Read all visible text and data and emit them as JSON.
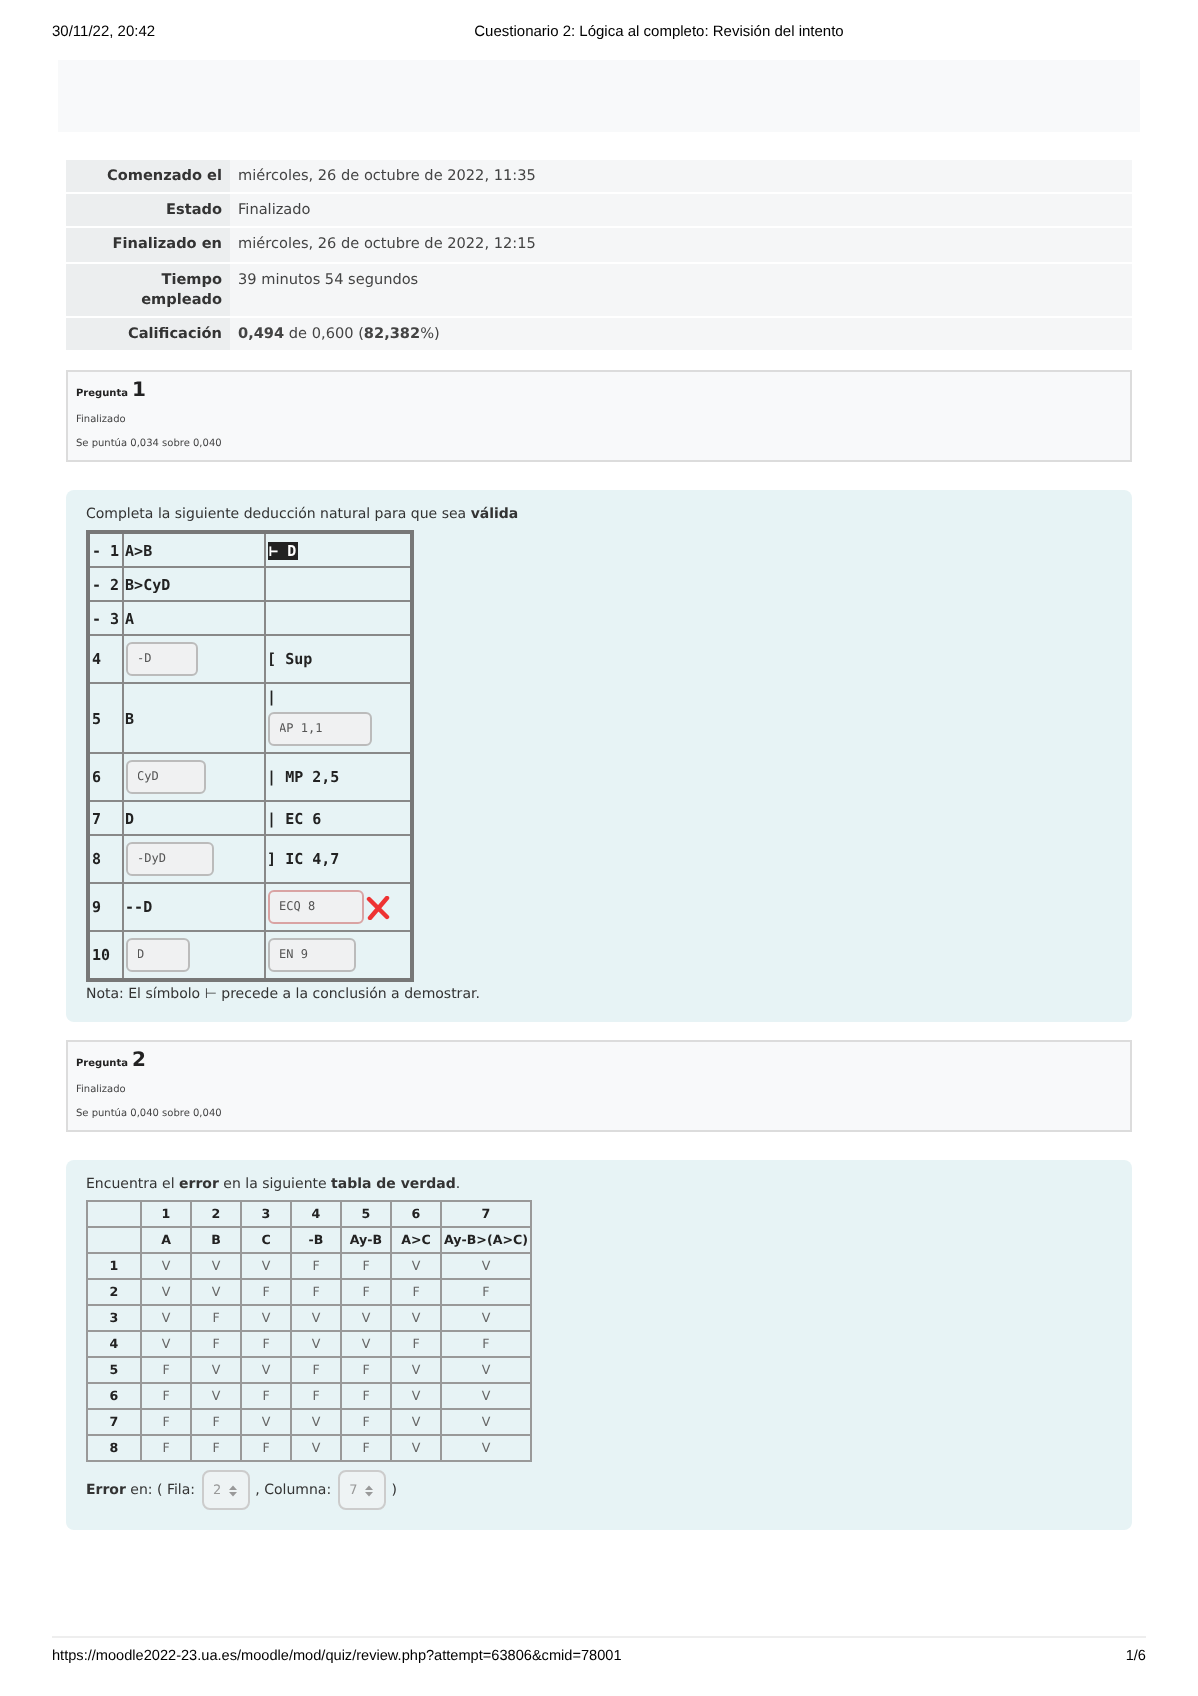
{
  "print_header": {
    "date": "30/11/22, 20:42",
    "title": "Cuestionario 2: Lógica al completo: Revisión del intento"
  },
  "summary": [
    {
      "label": "Comenzado el",
      "value": "miércoles, 26 de octubre de 2022, 11:35"
    },
    {
      "label": "Estado",
      "value": "Finalizado"
    },
    {
      "label": "Finalizado en",
      "value": "miércoles, 26 de octubre de 2022, 12:15"
    },
    {
      "label": "Tiempo empleado",
      "value": "39 minutos 54 segundos"
    },
    {
      "label": "Calificación",
      "value": "**0,494** de 0,600 (**82,382**%)"
    }
  ],
  "questions": [
    {
      "label": "Pregunta",
      "number": "1",
      "state": "Finalizado",
      "score": "Se puntúa 0,034 sobre 0,040",
      "kind": "deduction",
      "prompt": "Completa la siguiente deducción natural para que sea **válida**",
      "rows": [
        {
          "number": "- 1",
          "formula": {
            "kind": "text",
            "text": "A>B"
          },
          "justification": {
            "kind": "text",
            "text": "⊢ D",
            "highlighted": true
          }
        },
        {
          "number": "- 2",
          "formula": {
            "kind": "text",
            "text": "B>CyD"
          }
        },
        {
          "number": "- 3",
          "formula": {
            "kind": "text",
            "text": "A"
          }
        },
        {
          "number": "4",
          "formula": {
            "kind": "field",
            "value": "-D",
            "wrong": false
          },
          "justification": {
            "kind": "text",
            "text": "[ Sup",
            "highlighted": false
          }
        },
        {
          "number": "5",
          "formula": {
            "kind": "text",
            "text": "B"
          },
          "justification": {
            "kind": "field",
            "prefix": "|",
            "value": "AP 1,1",
            "wrong": false
          }
        },
        {
          "number": "6",
          "formula": {
            "kind": "field",
            "value": "CyD",
            "wrong": false
          },
          "justification": {
            "kind": "text",
            "text": "| MP 2,5",
            "highlighted": false
          }
        },
        {
          "number": "7",
          "formula": {
            "kind": "text",
            "text": "D"
          },
          "justification": {
            "kind": "text",
            "text": "| EC 6",
            "highlighted": false
          }
        },
        {
          "number": "8",
          "formula": {
            "kind": "field",
            "value": "-DyD",
            "wrong": false
          },
          "justification": {
            "kind": "text",
            "text": "] IC 4,7",
            "highlighted": false
          }
        },
        {
          "number": "9",
          "formula": {
            "kind": "text",
            "text": "--D"
          },
          "justification": {
            "kind": "field",
            "value": "ECQ 8",
            "wrong": true
          }
        },
        {
          "number": "10",
          "formula": {
            "kind": "field",
            "value": "D",
            "wrong": false
          },
          "justification": {
            "kind": "field",
            "value": "EN 9",
            "wrong": false
          }
        }
      ],
      "note": "Nota: El símbolo ⊢ precede a la conclusión a demostrar."
    },
    {
      "label": "Pregunta",
      "number": "2",
      "state": "Finalizado",
      "score": "Se puntúa 0,040 sobre 0,040",
      "kind": "truth_table",
      "prompt": "Encuentra el **error** en la siguiente **tabla de verdad**.",
      "header_rows": [
        [
          "",
          "1",
          "2",
          "3",
          "4",
          "5",
          "6",
          "7"
        ],
        [
          "",
          "A",
          "B",
          "C",
          "-B",
          "Ay-B",
          "A>C",
          "Ay-B>(A>C)"
        ]
      ],
      "rows": [
        [
          "1",
          "V",
          "V",
          "V",
          "F",
          "F",
          "V",
          "V"
        ],
        [
          "2",
          "V",
          "V",
          "F",
          "F",
          "F",
          "F",
          "F"
        ],
        [
          "3",
          "V",
          "F",
          "V",
          "V",
          "V",
          "V",
          "V"
        ],
        [
          "4",
          "V",
          "F",
          "F",
          "V",
          "V",
          "F",
          "F"
        ],
        [
          "5",
          "F",
          "V",
          "V",
          "F",
          "F",
          "V",
          "V"
        ],
        [
          "6",
          "F",
          "V",
          "F",
          "F",
          "F",
          "V",
          "V"
        ],
        [
          "7",
          "F",
          "F",
          "V",
          "V",
          "F",
          "V",
          "V"
        ],
        [
          "8",
          "F",
          "F",
          "F",
          "V",
          "F",
          "V",
          "V"
        ]
      ],
      "answer": {
        "lead": "**Error** en: ( Fila:",
        "row_value": "2",
        "middle": ", Columna:",
        "column_value": "7",
        "close": ")"
      }
    }
  ],
  "footer": {
    "url": "https://moodle2022-23.ua.es/moodle/mod/quiz/review.php?attempt=63806&cmid=78001",
    "page": "1/6"
  }
}
